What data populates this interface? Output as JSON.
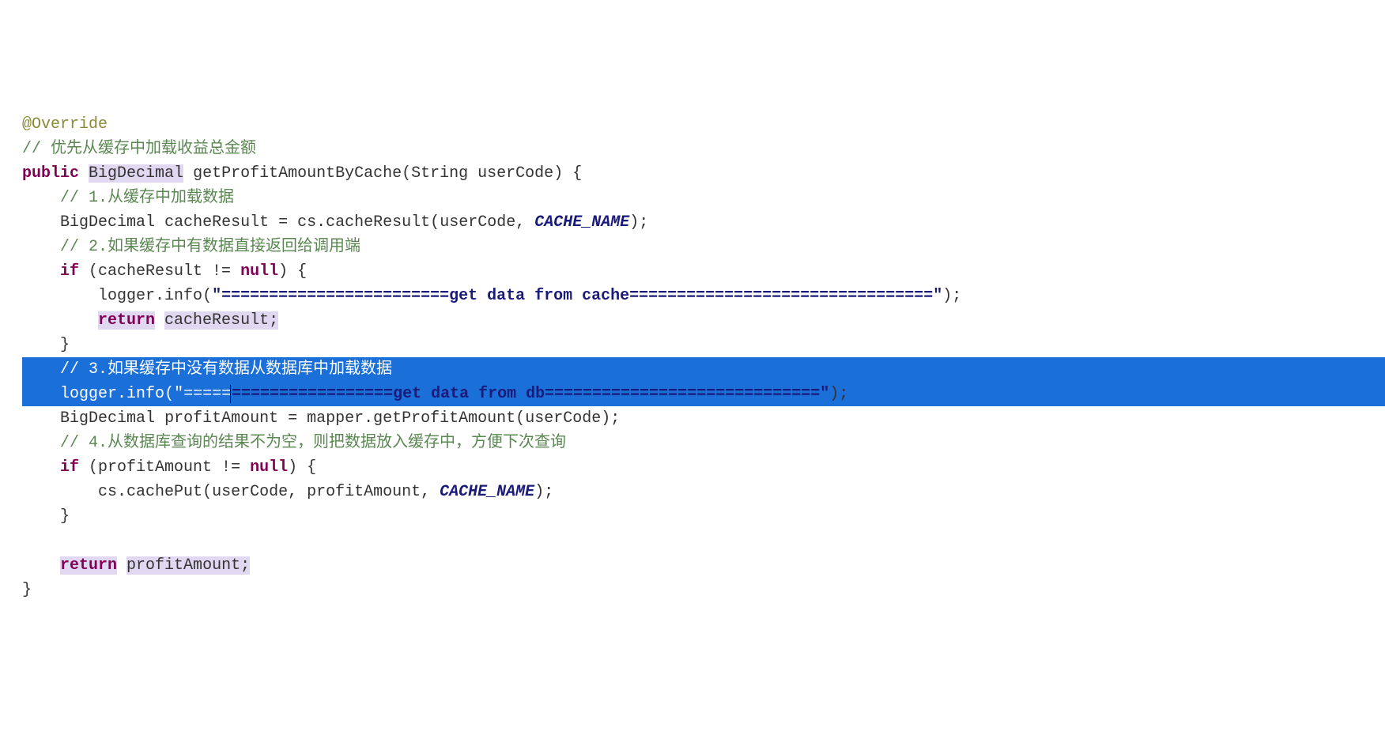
{
  "code": {
    "l1_annotation": "@Override",
    "l2_comment": "// 优先从缓存中加载收益总金额",
    "l3_public": "public",
    "l3_retType": "BigDecimal",
    "l3_method": "getProfitAmountByCache",
    "l3_paramType": "String",
    "l3_paramName": "userCode",
    "l3_tail": ") {",
    "l4_comment": "// 1.从缓存中加载数据",
    "l5_type": "BigDecimal",
    "l5_var": "cacheResult",
    "l5_eq": " = ",
    "l5_obj": "cs",
    "l5_call": "cacheResult",
    "l5_arg1": "userCode",
    "l5_arg2": "CACHE_NAME",
    "l5_tail": ");",
    "l6_comment": "// 2.如果缓存中有数据直接返回给调用端",
    "l7_if": "if",
    "l7_cond": " (cacheResult != ",
    "l7_null": "null",
    "l7_tail": ") {",
    "l8_logger": "logger",
    "l8_info": "info",
    "l8_str": "\"========================get data from cache================================\"",
    "l8_tail": ");",
    "l9_return": "return",
    "l9_var": "cacheResult",
    "l9_tail": ";",
    "l10_brace": "}",
    "l11_comment": "// 3.如果缓存中没有数据从数据库中加载数据",
    "l12_logger": "logger",
    "l12_info": "info",
    "l12_strA": "\"=====",
    "l12_strB": "=================get data from db=============================\"",
    "l12_tail": ");",
    "l13_type": "BigDecimal",
    "l13_var": "profitAmount",
    "l13_eq": " = ",
    "l13_obj": "mapper",
    "l13_call": "getProfitAmount",
    "l13_arg": "userCode",
    "l13_tail": ");",
    "l14_comment": "// 4.从数据库查询的结果不为空，则把数据放入缓存中，方便下次查询",
    "l15_if": "if",
    "l15_cond": " (profitAmount != ",
    "l15_null": "null",
    "l15_tail": ") {",
    "l16_obj": "cs",
    "l16_call": "cachePut",
    "l16_arg1": "userCode",
    "l16_arg2": "profitAmount",
    "l16_arg3": "CACHE_NAME",
    "l16_tail": ");",
    "l17_brace": "}",
    "l18_empty": "",
    "l19_return": "return",
    "l19_var": "profitAmount",
    "l19_tail": ";",
    "l20_brace": "}"
  }
}
